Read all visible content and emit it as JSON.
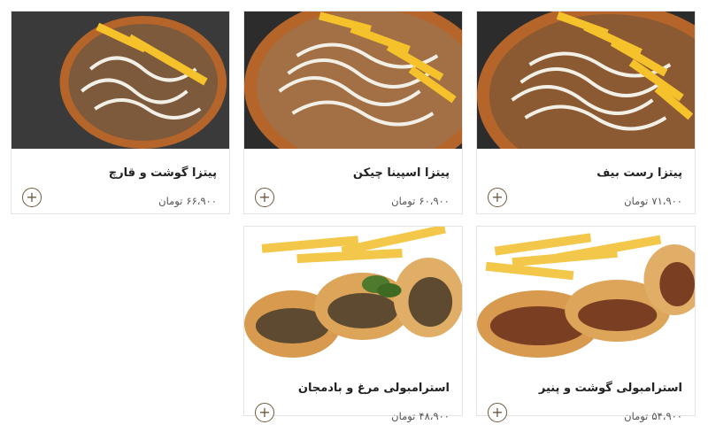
{
  "currency": "تومان",
  "products": [
    {
      "name": "پیتزا رست بیف",
      "price": "۷۱،۹۰۰",
      "add_icon": "plus-icon",
      "image": "pizza"
    },
    {
      "name": "پیتزا اسپینا چیکن",
      "price": "۶۰،۹۰۰",
      "add_icon": "plus-icon",
      "image": "pizza"
    },
    {
      "name": "پیتزا گوشت و قارچ",
      "price": "۶۶،۹۰۰",
      "add_icon": "plus-icon",
      "image": "pizza"
    },
    {
      "name": "استرامبولی گوشت و پنیر",
      "price": "۵۴،۹۰۰",
      "add_icon": "plus-icon",
      "image": "stromboli"
    },
    {
      "name": "استرامبولی مرغ و بادمجان",
      "price": "۴۸،۹۰۰",
      "add_icon": "plus-icon",
      "image": "stromboli"
    }
  ],
  "colors": {
    "accent": "#6e5a3e",
    "border": "#e3e3e3"
  }
}
